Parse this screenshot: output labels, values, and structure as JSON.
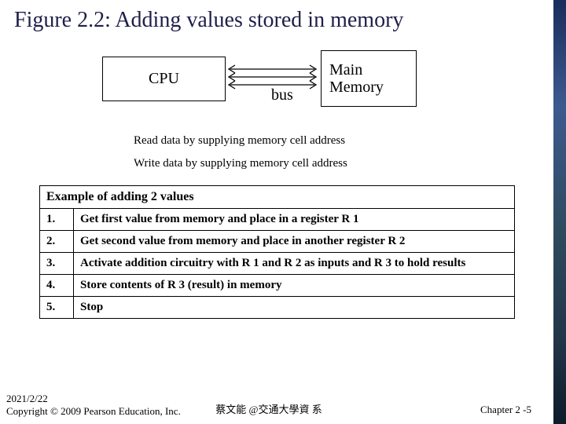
{
  "title": "Figure 2.2:  Adding values stored in memory",
  "diagram": {
    "cpu": "CPU",
    "memory": "Main\nMemory",
    "bus": "bus"
  },
  "notes": {
    "read": "Read data by supplying memory cell address",
    "write": "Write data by supplying memory cell address"
  },
  "example": {
    "heading": "Example of adding 2 values",
    "steps": [
      {
        "n": "1.",
        "t": "Get first value from memory and place in a register R 1"
      },
      {
        "n": "2.",
        "t": "Get second value from memory and place in another register R 2"
      },
      {
        "n": "3.",
        "t": "Activate addition circuitry with R 1 and R 2 as inputs and R 3 to hold results"
      },
      {
        "n": "4.",
        "t": "Store contents of R 3 (result) in memory"
      },
      {
        "n": "5.",
        "t": "Stop"
      }
    ]
  },
  "footer": {
    "date": "2021/2/22",
    "copy": "Copyright © 2009 Pearson Education, Inc.",
    "center": "蔡文能 @交通大學資 系",
    "right": "Chapter 2 -5"
  }
}
